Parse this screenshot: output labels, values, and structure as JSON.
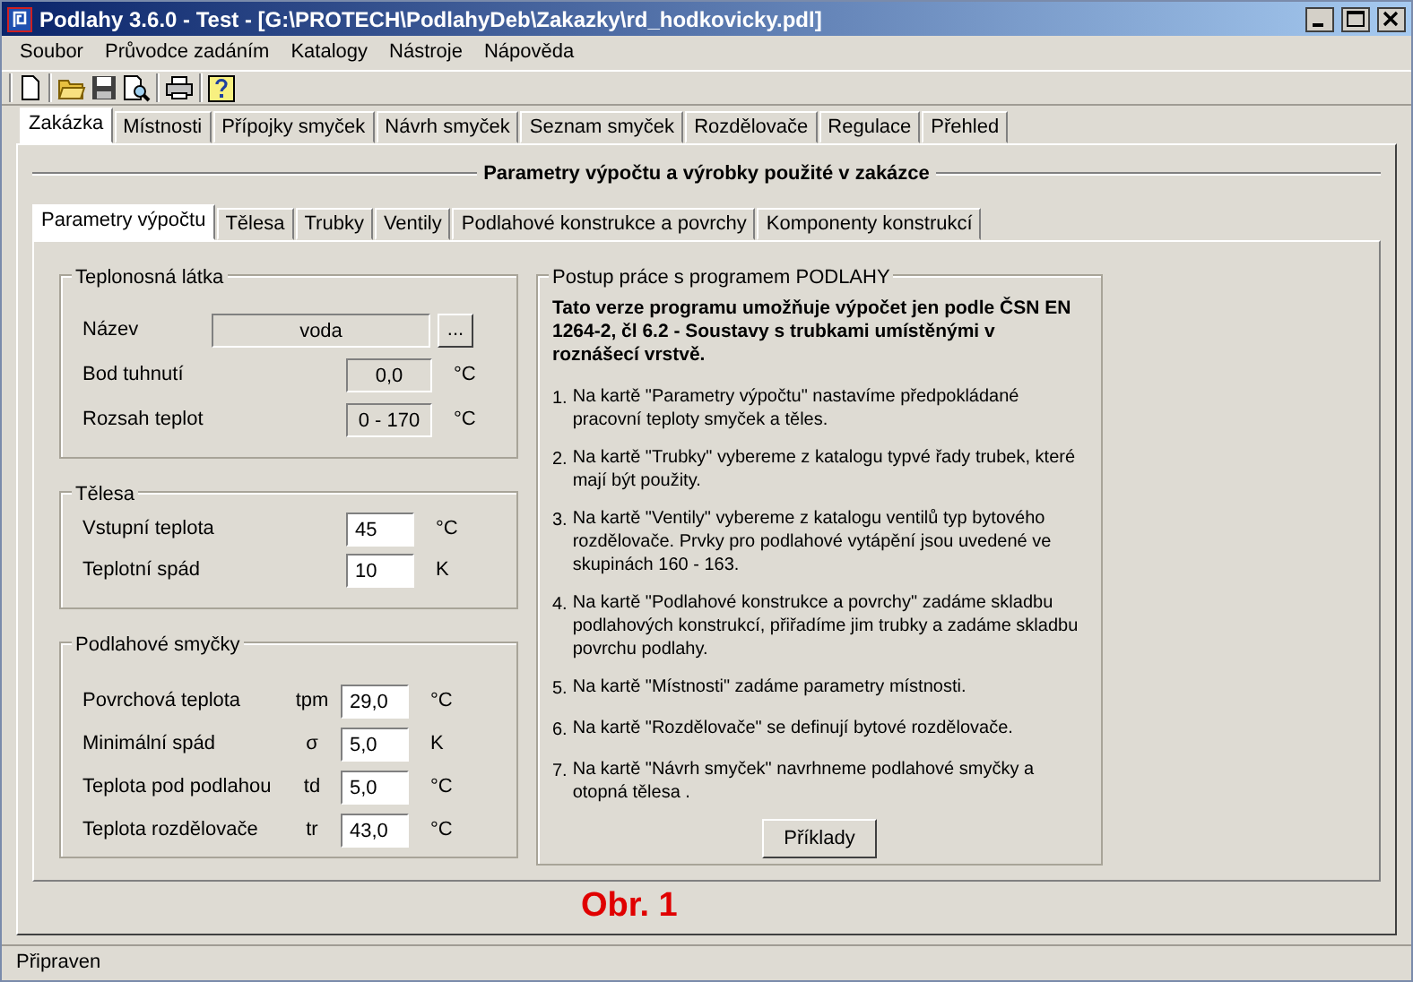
{
  "window": {
    "title": "Podlahy 3.6.0 - Test - [G:\\PROTECH\\PodlahyDeb\\Zakazky\\rd_hodkovicky.pdl]"
  },
  "menu": [
    "Soubor",
    "Průvodce zadáním",
    "Katalogy",
    "Nástroje",
    "Nápověda"
  ],
  "tabs": [
    {
      "label": "Zakázka",
      "selected": true
    },
    {
      "label": "Místnosti",
      "selected": false
    },
    {
      "label": "Přípojky smyček",
      "selected": false
    },
    {
      "label": "Návrh smyček",
      "selected": false
    },
    {
      "label": "Seznam smyček",
      "selected": false
    },
    {
      "label": "Rozdělovače",
      "selected": false
    },
    {
      "label": "Regulace",
      "selected": false
    },
    {
      "label": "Přehled",
      "selected": false
    }
  ],
  "section_title": "Parametry výpočtu a výrobky použité v zakázce",
  "subtabs": [
    {
      "label": "Parametry výpočtu",
      "selected": true
    },
    {
      "label": "Tělesa",
      "selected": false
    },
    {
      "label": "Trubky",
      "selected": false
    },
    {
      "label": "Ventily",
      "selected": false
    },
    {
      "label": "Podlahové konstrukce a povrchy",
      "selected": false
    },
    {
      "label": "Komponenty konstrukcí",
      "selected": false
    }
  ],
  "groups": [
    {
      "title": "Teplonosná  látka",
      "rows": [
        {
          "kind": "picker",
          "label": "Název",
          "value": "voda",
          "button": "..."
        },
        {
          "kind": "readonly",
          "label": "Bod tuhnutí",
          "value": "0,0",
          "unit": "°C"
        },
        {
          "kind": "readonly",
          "label": "Rozsah teplot",
          "value": "0 - 170",
          "unit": "°C"
        }
      ]
    },
    {
      "title": "Tělesa",
      "rows": [
        {
          "kind": "input",
          "label": "Vstupní teplota",
          "value": "45",
          "unit": "°C"
        },
        {
          "kind": "input",
          "label": "Teplotní spád",
          "value": "10",
          "unit": "K"
        }
      ]
    },
    {
      "title": "Podlahové smyčky",
      "rows": [
        {
          "kind": "input",
          "label": "Povrchová teplota",
          "symbol": "tpm",
          "value": "29,0",
          "unit": "°C"
        },
        {
          "kind": "input",
          "label": "Minimální spád",
          "symbol": "σ",
          "value": "5,0",
          "unit": "K"
        },
        {
          "kind": "input",
          "label": "Teplota pod podlahou",
          "symbol": "td",
          "value": "5,0",
          "unit": "°C"
        },
        {
          "kind": "input",
          "label": "Teplota rozdělovače",
          "symbol": "tr",
          "value": "43,0",
          "unit": "°C"
        }
      ]
    }
  ],
  "instructions": {
    "title": "Postup  práce s programem PODLAHY",
    "intro": "Tato verze programu umožňuje výpočet jen podle ČSN EN 1264-2, čl 6.2 - Soustavy s trubkami umístěnými v roznášecí vrstvě.",
    "steps": [
      {
        "number": "1.",
        "text": "Na kartě \"Parametry výpočtu\"  nastavíme předpokládané pracovní teploty smyček a těles."
      },
      {
        "number": "2.",
        "text": "Na kartě \"Trubky\" vybereme z katalogu typvé řady trubek, které mají být použity."
      },
      {
        "number": "3.",
        "text": "Na kartě \"Ventily\" vybereme z katalogu ventilů typ bytového rozdělovače. Prvky pro podlahové vytápění jsou uvedené ve skupinách 160 - 163."
      },
      {
        "number": "4.",
        "text": "Na kartě \"Podlahové konstrukce a povrchy\" zadáme skladbu podlahových konstrukcí, přiřadíme jim trubky a zadáme skladbu povrchu podlahy."
      },
      {
        "number": "5.",
        "text": "Na kartě \"Místnosti\" zadáme parametry místnosti."
      },
      {
        "number": "6.",
        "text": "Na kartě \"Rozdělovače\" se definují bytové rozdělovače."
      },
      {
        "number": "7.",
        "text": "Na kartě \"Návrh smyček\" navrhneme podlahové smyčky a otopná tělesa ."
      }
    ],
    "button": "Příklady"
  },
  "caption": "Obr. 1",
  "status_bar": "Připraven"
}
